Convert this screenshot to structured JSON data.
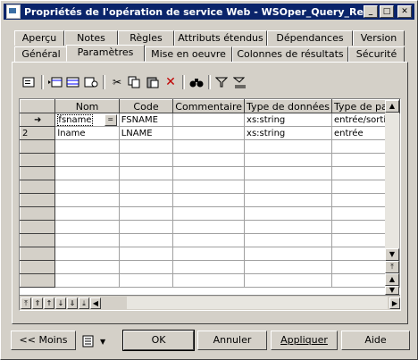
{
  "window": {
    "title": "Propriétés de l'opération de service Web - WSOper_Query_Resul..."
  },
  "tabs_row1": [
    "Aperçu",
    "Notes",
    "Règles",
    "Attributs étendus",
    "Dépendances",
    "Version"
  ],
  "tabs_row2": [
    "Général",
    "Paramètres",
    "Mise en oeuvre",
    "Colonnes de résultats",
    "Sécurité"
  ],
  "active_tab": "Paramètres",
  "grid": {
    "columns": [
      "Nom",
      "Code",
      "Commentaire",
      "Type de données",
      "Type de para"
    ],
    "rows": [
      {
        "marker": "➜",
        "name": "fsname",
        "code": "FSNAME",
        "comment": "",
        "datatype": "xs:string",
        "paramtype": "entrée/sortie"
      },
      {
        "marker": "2",
        "name": "lname",
        "code": "LNAME",
        "comment": "",
        "datatype": "xs:string",
        "paramtype": "entrée"
      }
    ]
  },
  "buttons": {
    "less": "<< Moins",
    "ok": "OK",
    "cancel": "Annuler",
    "apply": "Appliquer",
    "help": "Aide"
  }
}
